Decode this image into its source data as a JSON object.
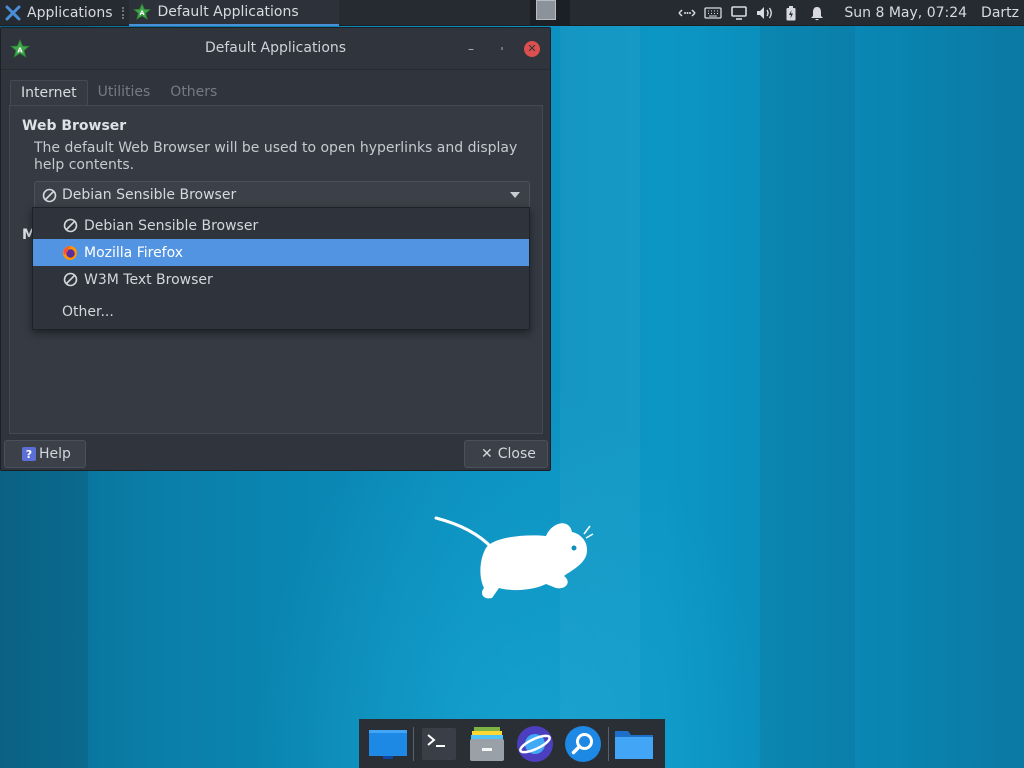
{
  "top_panel": {
    "app_menu_label": "Applications",
    "task_label": "Default Applications",
    "clock": "Sun  8 May, 07:24",
    "user": "Dartz",
    "tray_icons": [
      "network-icon",
      "keyboard-icon",
      "display-icon",
      "volume-icon",
      "battery-icon",
      "notifications-bell-icon"
    ]
  },
  "window": {
    "title": "Default Applications",
    "tabs": [
      {
        "label": "Internet",
        "active": true
      },
      {
        "label": "Utilities",
        "active": false
      },
      {
        "label": "Others",
        "active": false
      }
    ],
    "web_browser": {
      "title": "Web Browser",
      "description": "The default Web Browser will be used to open hyperlinks and display help contents.",
      "selected": "Debian Sensible Browser"
    },
    "mail_reader_title_partial": "M",
    "help_label": "Help",
    "close_label": "Close"
  },
  "dropdown": {
    "items": [
      {
        "label": "Debian Sensible Browser",
        "icon": "no-icon",
        "selected": false
      },
      {
        "label": "Mozilla Firefox",
        "icon": "firefox-icon",
        "selected": true
      },
      {
        "label": "W3M Text Browser",
        "icon": "no-icon",
        "selected": false
      }
    ],
    "other_label": "Other..."
  },
  "dock": {
    "items": [
      "show-desktop-icon",
      "terminal-icon",
      "file-manager-drawer-icon",
      "web-browser-icon",
      "app-finder-icon",
      "home-folder-icon"
    ]
  },
  "colors": {
    "accent": "#5294e2",
    "desktop": "#0b8fbd",
    "panel": "#262a31",
    "window": "#30343c"
  }
}
